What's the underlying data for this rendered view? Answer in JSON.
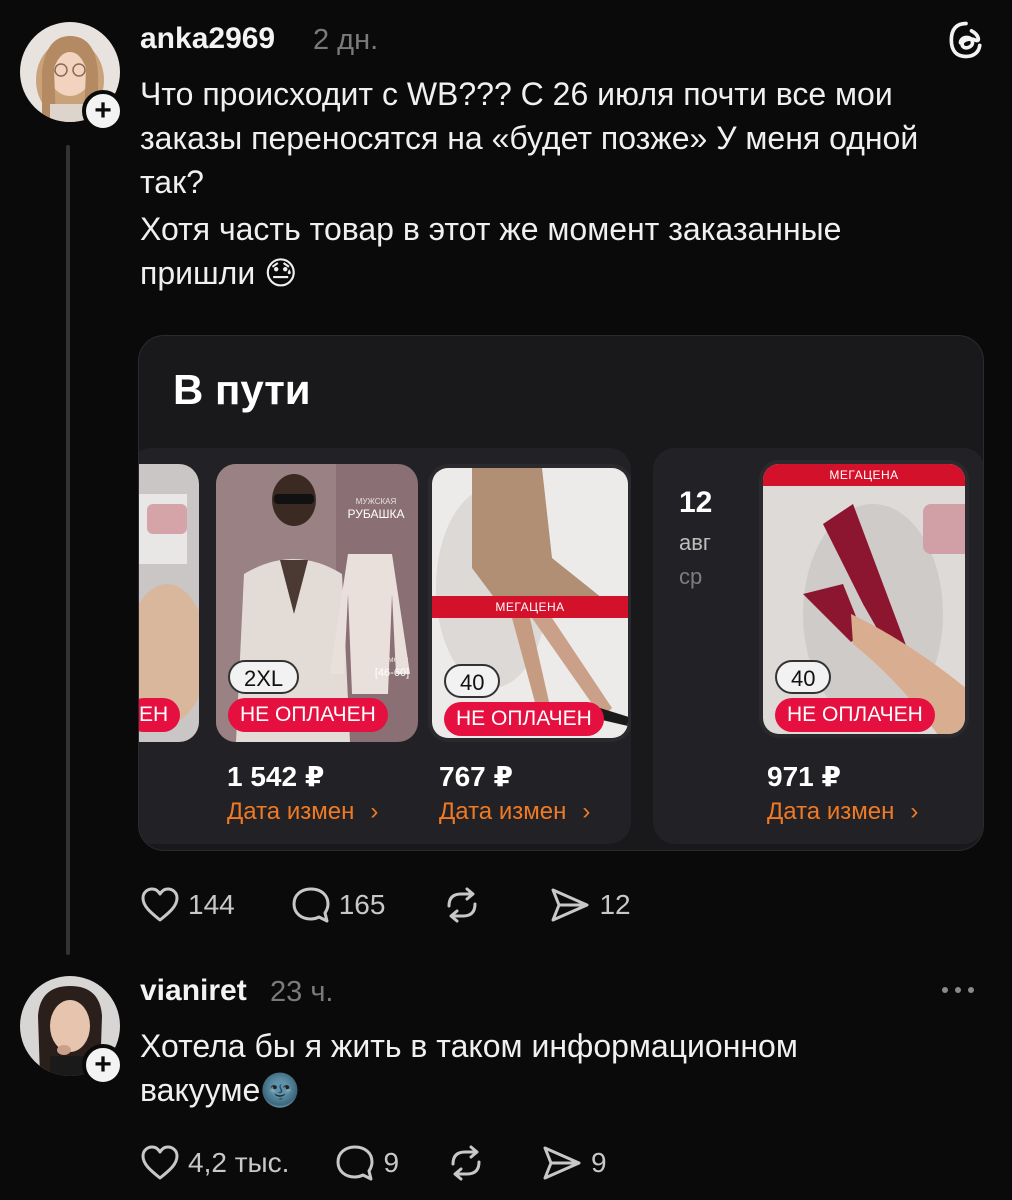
{
  "post": {
    "username": "anka2969",
    "time": "2 дн.",
    "paragraphs": [
      "Что происходит с WB??? С 26 июля почти все мои заказы переносятся на «будет позже»   У меня одной так?",
      "Хотя часть товар в этот же момент заказанные пришли 😓"
    ],
    "screenshot": {
      "title": "В пути",
      "products": [
        {
          "size": "2XL",
          "status": "НЕ ОПЛАЧЕН",
          "price": "1 542 ₽",
          "action": "Дата измен",
          "tag": "РУБАШКА",
          "tag_small": "МУЖСКАЯ",
          "size_label": "размеры",
          "size_range": "[46-60]"
        },
        {
          "size": "40",
          "status": "НЕ ОПЛАЧЕН",
          "price": "767 ₽",
          "action": "Дата измен",
          "banner": "МЕГАЦЕНА"
        },
        {
          "size": "40",
          "status": "НЕ ОПЛАЧЕН",
          "price": "971 ₽",
          "action": "Дата измен",
          "banner": "МЕГАЦЕНА"
        }
      ],
      "partial_status": "ЕН",
      "date": {
        "day": "12",
        "month": "авг",
        "weekday": "ср"
      }
    },
    "stats": {
      "likes": "144",
      "comments": "165",
      "shares": "12"
    }
  },
  "reply": {
    "username": "vianiret",
    "time": "23 ч.",
    "paragraphs": [
      "Хотела бы я жить в таком информационном вакууме🌚"
    ],
    "stats": {
      "likes": "4,2 тыс.",
      "comments": "9",
      "shares": "9"
    }
  },
  "icons": {
    "like": "heart-icon",
    "comment": "comment-bubble-icon",
    "repost": "repost-icon",
    "share": "send-icon",
    "menu": "more-icon",
    "app": "threads-logo"
  }
}
